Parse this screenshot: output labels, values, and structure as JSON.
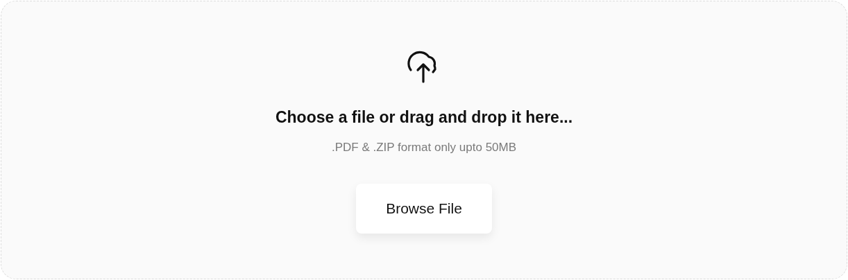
{
  "dropzone": {
    "title": "Choose a file or drag and drop it here...",
    "hint": ".PDF & .ZIP format only upto 50MB",
    "button": "Browse File"
  }
}
